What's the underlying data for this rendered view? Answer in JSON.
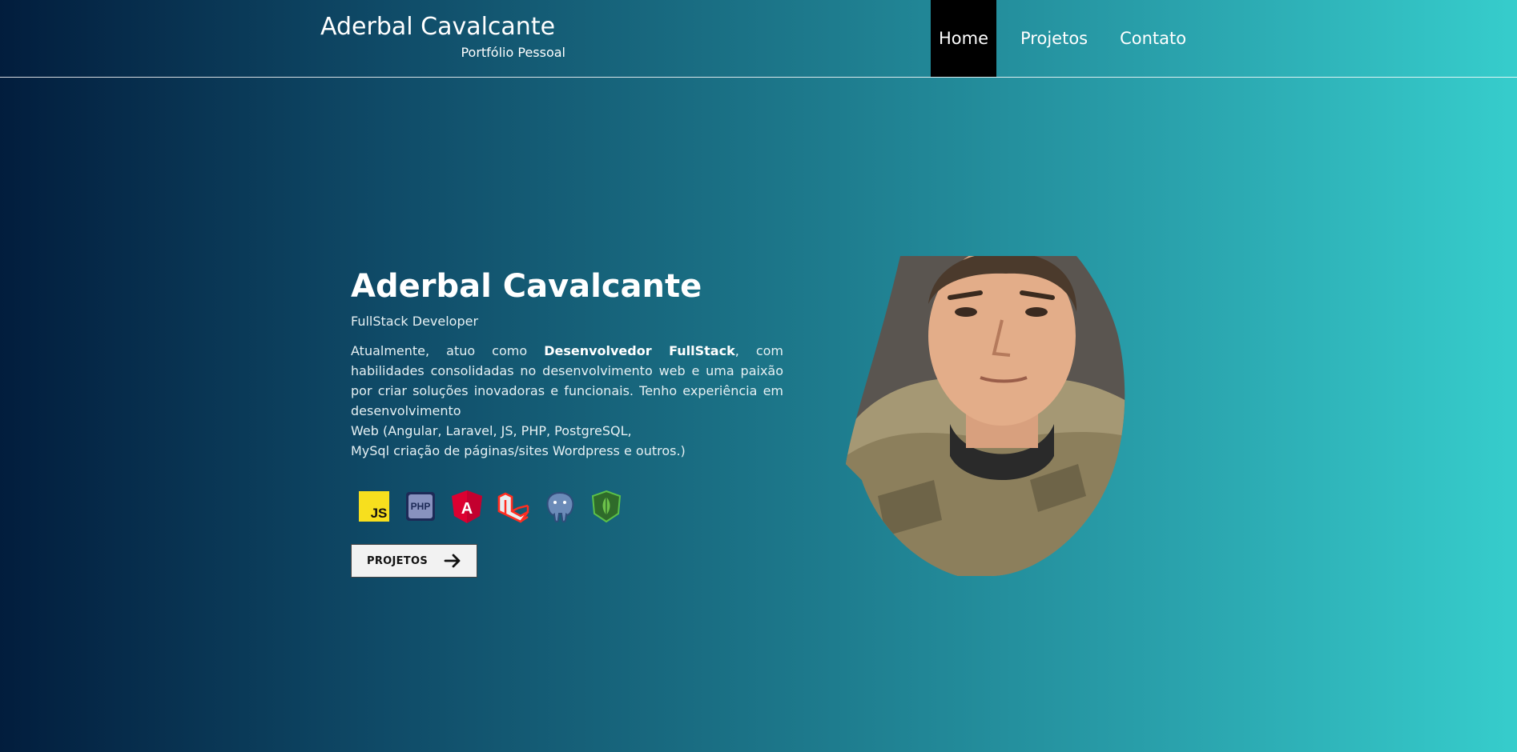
{
  "header": {
    "brand_title": "Aderbal Cavalcante",
    "brand_subtitle": "Portfólio Pessoal"
  },
  "nav": {
    "items": [
      {
        "label": "Home",
        "active": true
      },
      {
        "label": "Projetos",
        "active": false
      },
      {
        "label": "Contato",
        "active": false
      }
    ]
  },
  "hero": {
    "name": "Aderbal Cavalcante",
    "role": "FullStack Developer",
    "desc_prefix": "Atualmente, atuo como ",
    "desc_bold": "Desenvolvedor FullStack",
    "desc_suffix": ", com habilidades consolidadas no desenvolvimento web e uma paixão por criar soluções inovadoras e funcionais. Tenho experiência em desenvolvimento",
    "desc_line2": "Web (Angular, Laravel, JS, PHP, PostgreSQL,",
    "desc_line3": "MySql criação de páginas/sites Wordpress e outros.)",
    "button_label": "PROJETOS"
  },
  "techs": {
    "js_label": "JS",
    "php_label": "PHP",
    "angular_label": "A",
    "items": [
      "javascript-icon",
      "php-icon",
      "angular-icon",
      "laravel-icon",
      "postgresql-icon",
      "mongodb-icon"
    ]
  },
  "colors": {
    "gradient_start": "#021d3d",
    "gradient_end": "#36cdcc",
    "active_nav_bg": "#000000",
    "button_bg": "#f2f2f2"
  }
}
